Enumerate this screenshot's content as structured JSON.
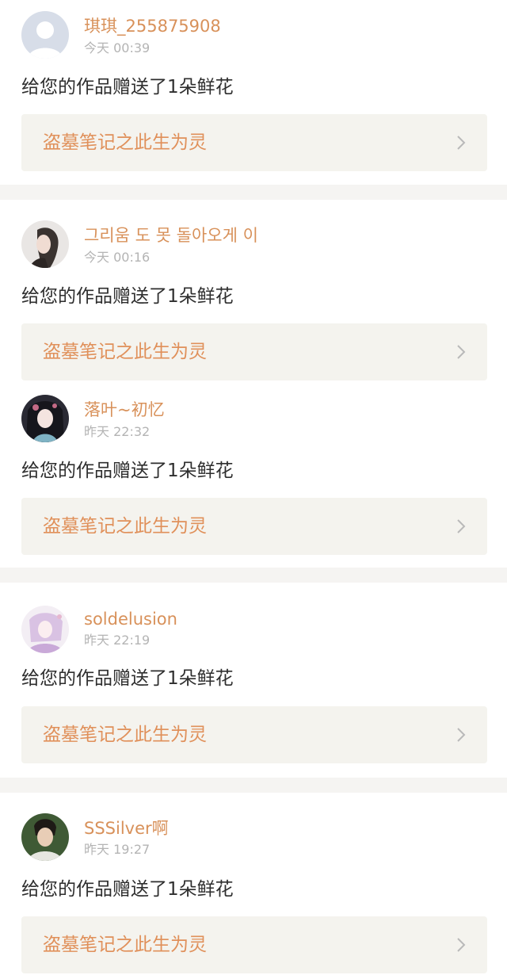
{
  "notifications": [
    {
      "username": "琪琪_255875908",
      "time": "今天 00:39",
      "message": "给您的作品赠送了1朵鲜花",
      "work_title": "盗墓笔记之此生为灵",
      "avatar": "default-avatar-icon"
    },
    {
      "username": "그리움 도 못 돌아오게 이",
      "time": "今天 00:16",
      "message": "给您的作品赠送了1朵鲜花",
      "work_title": "盗墓笔记之此生为灵",
      "avatar": "user-avatar"
    },
    {
      "username": "落叶~初忆",
      "time": "昨天 22:32",
      "message": "给您的作品赠送了1朵鲜花",
      "work_title": "盗墓笔记之此生为灵",
      "avatar": "user-avatar"
    },
    {
      "username": "soldelusion",
      "time": "昨天 22:19",
      "message": "给您的作品赠送了1朵鲜花",
      "work_title": "盗墓笔记之此生为灵",
      "avatar": "user-avatar"
    },
    {
      "username": "SSSilver啊",
      "time": "昨天 19:27",
      "message": "给您的作品赠送了1朵鲜花",
      "work_title": "盗墓笔记之此生为灵",
      "avatar": "user-avatar"
    }
  ],
  "colors": {
    "username": "#d8915a",
    "time": "#b4b4b4",
    "message": "#2e2e2e",
    "work_title": "#e0905a",
    "work_box_bg": "#f4f3ee",
    "separator": "#f5f4f2"
  }
}
